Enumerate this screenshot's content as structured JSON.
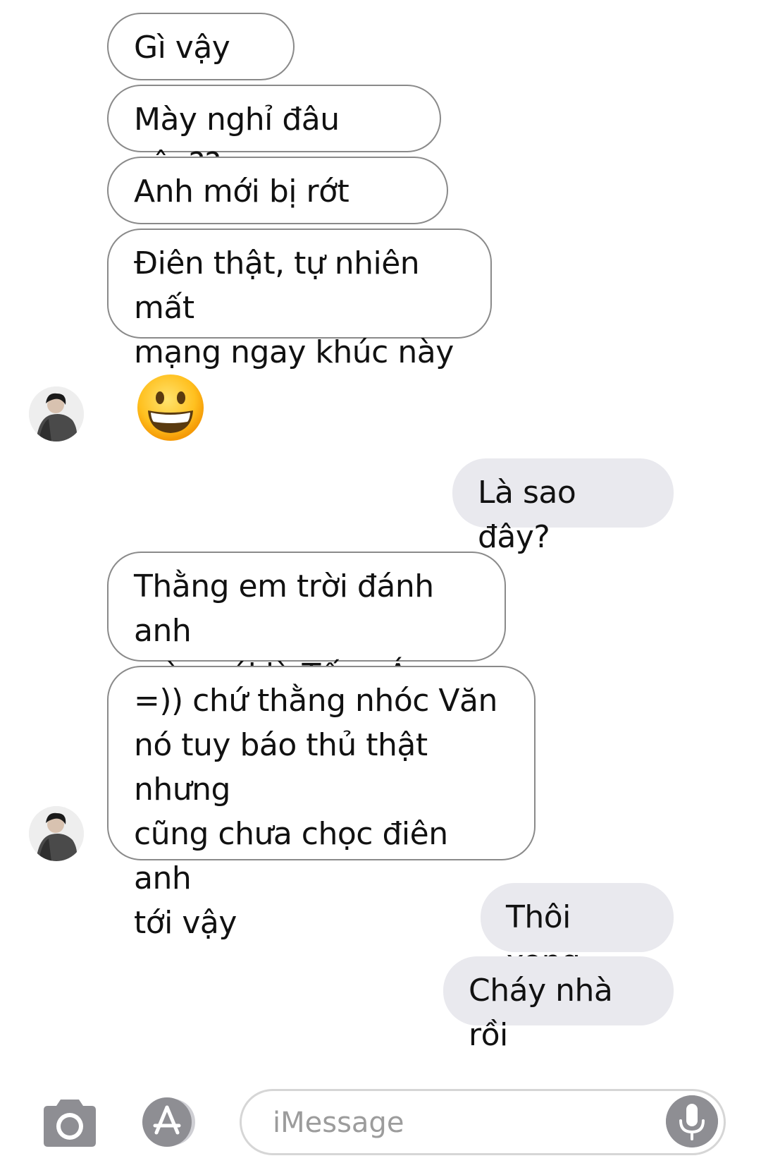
{
  "conversation": {
    "received_1": [
      "Gì vậy em",
      "Mày nghỉ đâu vậy??",
      "Anh mới bị rớt mạng",
      "Điên thật, tự nhiên mất\nmạng ngay khúc này"
    ],
    "sent_1": [
      "Là sao đây?"
    ],
    "received_2": [
      "Thằng em trời đánh anh\nmày nói là Tống Á Hiên",
      "=)) chứ thằng nhóc Văn\nnó tuy báo thủ thật nhưng\ncũng chưa chọc điên anh\ntới vậy"
    ],
    "sent_2": [
      "Thôi xong",
      "Cháy nhà rồi"
    ]
  },
  "input_bar": {
    "placeholder": "iMessage",
    "icons": [
      "camera-icon",
      "app-store-icon",
      "microphone-icon"
    ]
  },
  "colors": {
    "received_bubble_border": "#8a8a8a",
    "sent_bubble_bg": "#e9e9ee",
    "icon_gray": "#8e8e93"
  }
}
